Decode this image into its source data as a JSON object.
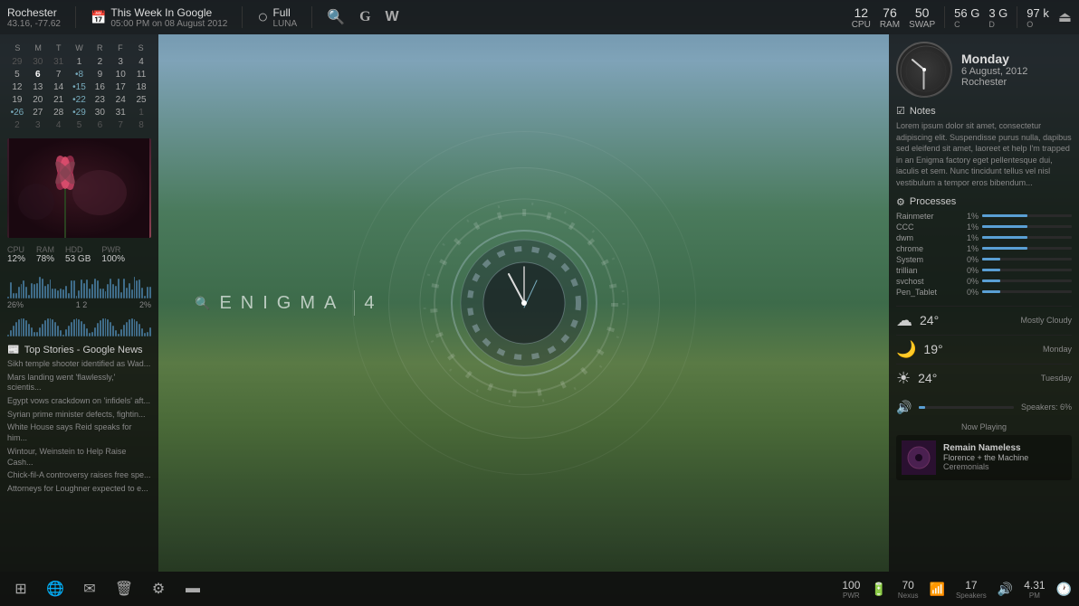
{
  "topbar": {
    "location": {
      "city": "Rochester",
      "coords": "43.16, -77.62"
    },
    "calendar": {
      "label": "This Week In Google",
      "time": "05:00 PM on 08 August 2012"
    },
    "moon": {
      "phase": "Full",
      "label": "LUNA"
    },
    "metrics": {
      "cpu": {
        "label": "CPU",
        "value": "12"
      },
      "ram": {
        "label": "RAM",
        "value": "76"
      },
      "swap": {
        "label": "SWAP",
        "value": "50"
      },
      "c": {
        "label": "C",
        "value": "56 G"
      },
      "d": {
        "label": "D",
        "value": "3 G"
      },
      "o": {
        "label": "O",
        "value": "97 k"
      }
    }
  },
  "left_panel": {
    "calendar": {
      "days_header": [
        "S",
        "M",
        "T",
        "W",
        "R",
        "F",
        "S"
      ],
      "rows": [
        [
          "29",
          "30",
          "31",
          "1",
          "2",
          "3",
          "4"
        ],
        [
          "5",
          "6",
          "7",
          "•8",
          "9",
          "10",
          "11"
        ],
        [
          "12",
          "13",
          "14",
          "•15",
          "16",
          "17",
          "18"
        ],
        [
          "19",
          "20",
          "21",
          "•22",
          "23",
          "24",
          "25"
        ],
        [
          "•26",
          "27",
          "28",
          "•29",
          "30",
          "31",
          "1"
        ],
        [
          "2",
          "3",
          "4",
          "5",
          "6",
          "7",
          "8"
        ]
      ],
      "week_numbers": [
        "",
        "",
        "",
        "",
        "•26",
        ""
      ],
      "today": "6"
    },
    "cpu": {
      "label": "CPU",
      "value": "12%"
    },
    "ram": {
      "label": "RAM",
      "value": "78%"
    },
    "hdd_label": "53 GB",
    "hdd_pwr": "100%",
    "hdd_title": "HDD",
    "pwr_title": "PWR",
    "disk_percent": "26%",
    "disk_nums": "1  2",
    "disk_pct2": "2%",
    "news": {
      "title": "Top Stories - Google News",
      "items": [
        "Sikh temple shooter identified as Wad...",
        "Mars landing went 'flawlessly,' scientis...",
        "Egypt vows crackdown on 'infidels' aft...",
        "Syrian prime minister defects, fightin...",
        "White House says Reid speaks for him...",
        "Wintour, Weinstein to Help Raise Cash...",
        "Chick-fil-A controversy raises free spe...",
        "Attorneys for Loughner expected to e..."
      ]
    }
  },
  "center": {
    "enigma_label": "ENIGMA",
    "enigma_number": "4",
    "clock_hour_angle": 310,
    "clock_min_angle": 180,
    "clock_sec_angle": 90
  },
  "right_panel": {
    "clock": {
      "day": "Monday",
      "date": "6 August, 2012",
      "city": "Rochester"
    },
    "notes": {
      "title": "Notes",
      "text": "Lorem ipsum dolor sit amet, consectetur adipiscing elit. Suspendisse purus nulla, dapibus sed eleifend sit amet, laoreet et help I'm trapped in an Enigma factory eget pellentesque dui, iaculis et sem. Nunc tincidunt tellus vel nisl vestibulum a tempor eros bibendum..."
    },
    "processes": {
      "title": "Processes",
      "items": [
        {
          "name": "Rainmeter",
          "pct": "1%",
          "bar": 5
        },
        {
          "name": "CCC",
          "pct": "1%",
          "bar": 5
        },
        {
          "name": "dwm",
          "pct": "1%",
          "bar": 5
        },
        {
          "name": "chrome",
          "pct": "1%",
          "bar": 5
        },
        {
          "name": "System",
          "pct": "0%",
          "bar": 2
        },
        {
          "name": "trillian",
          "pct": "0%",
          "bar": 2
        },
        {
          "name": "svchost",
          "pct": "0%",
          "bar": 2
        },
        {
          "name": "Pen_Tablet",
          "pct": "0%",
          "bar": 2
        }
      ]
    },
    "weather": [
      {
        "icon": "☁",
        "temp": "24°",
        "desc": "Mostly Cloudy",
        "day": ""
      },
      {
        "icon": "🌙",
        "temp": "19°",
        "desc": "",
        "day": "Monday"
      },
      {
        "icon": "☀",
        "temp": "24°",
        "desc": "",
        "day": "Tuesday"
      }
    ],
    "volume": {
      "label": "Speakers: 6%",
      "value": 6
    },
    "now_playing": {
      "label": "Now Playing",
      "title": "Remain Nameless",
      "artist": "Florence + the Machine",
      "album": "Ceremonials"
    }
  },
  "taskbar": {
    "items": [
      {
        "name": "start-button",
        "icon": "⊞"
      },
      {
        "name": "browser-button",
        "icon": "🌐"
      },
      {
        "name": "email-button",
        "icon": "✉"
      },
      {
        "name": "trash-button",
        "icon": "🗑"
      },
      {
        "name": "settings-button",
        "icon": "⚙"
      },
      {
        "name": "wallet-button",
        "icon": "💳"
      }
    ],
    "right": {
      "pwr": "100",
      "pwr_label": "PWR",
      "nexus": "70",
      "nexus_label": "Nexus",
      "speakers": "17",
      "speakers_label": "Speakers",
      "time": "4.31",
      "time_label": "PM"
    }
  }
}
